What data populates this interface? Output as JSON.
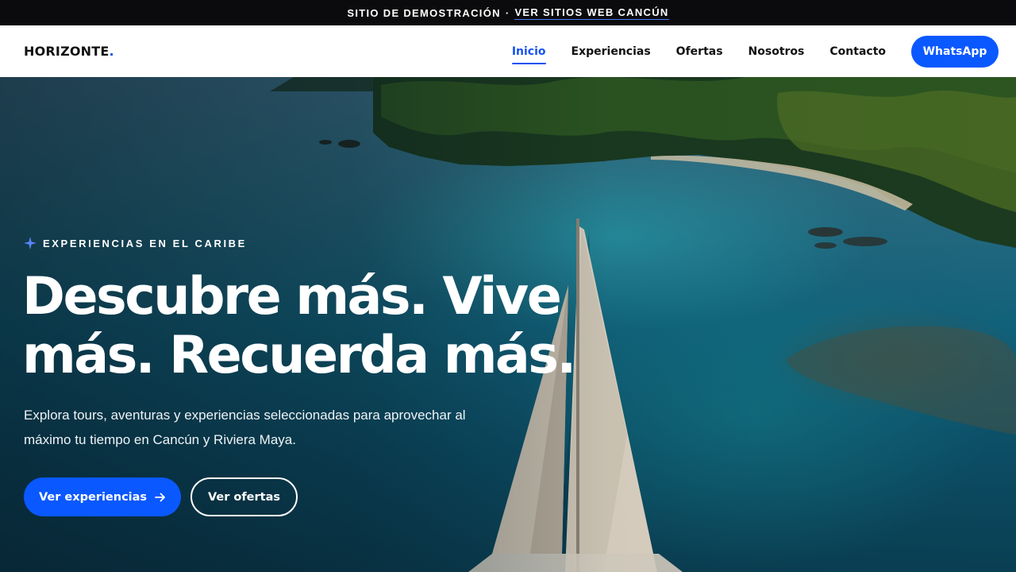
{
  "topbar": {
    "demo_text": "SITIO DE DEMOSTRACIÓN",
    "separator": "·",
    "link_text": "VER SITIOS WEB CANCÚN"
  },
  "header": {
    "logo_text": "HORIZONTE",
    "logo_dot": ".",
    "nav": {
      "home": "Inicio",
      "experiences": "Experiencias",
      "offers": "Ofertas",
      "about": "Nosotros",
      "contact": "Contacto"
    },
    "whatsapp_label": "WhatsApp"
  },
  "hero": {
    "eyebrow_icon": "sparkle-icon",
    "eyebrow": "EXPERIENCIAS EN EL CARIBE",
    "headline": "Descubre más. Vive más. Recuerda más.",
    "subtext": "Explora tours, aventuras y experiencias seleccionadas para aprovechar al máximo tu tiempo en Cancún y Riviera Maya.",
    "primary_cta": "Ver experiencias",
    "primary_cta_icon": "arrow-right-icon",
    "secondary_cta": "Ver ofertas"
  },
  "colors": {
    "accent": "#0a58ff",
    "topbar_bg": "#0b0b0d",
    "active_nav": "#1652f0"
  }
}
